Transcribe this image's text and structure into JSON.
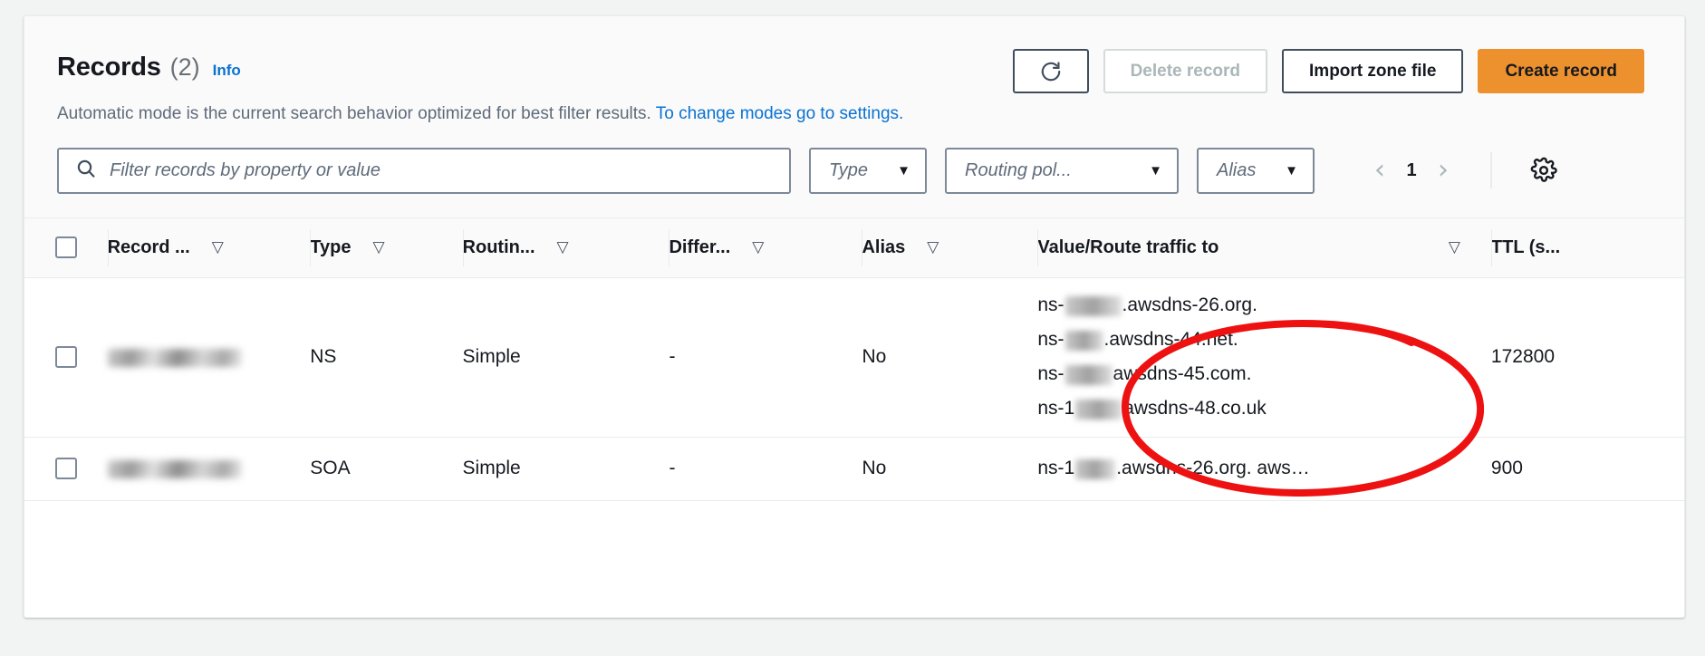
{
  "panel": {
    "title": "Records",
    "count": "(2)",
    "info_label": "Info",
    "description_text": "Automatic mode is the current search behavior optimized for best filter results.",
    "description_link": "To change modes go to settings."
  },
  "toolbar": {
    "refresh_icon": "refresh-icon",
    "delete_label": "Delete record",
    "import_label": "Import zone file",
    "create_label": "Create record",
    "delete_disabled": true
  },
  "filters": {
    "search_placeholder": "Filter records by property or value",
    "search_value": "",
    "search_icon": "search-icon",
    "type_label": "Type",
    "routing_label": "Routing pol...",
    "alias_label": "Alias",
    "caret_icon": "chevron-down-icon"
  },
  "pagination": {
    "prev_icon": "chevron-left-icon",
    "page": "1",
    "next_icon": "chevron-right-icon",
    "settings_icon": "gear-icon"
  },
  "table": {
    "columns": [
      {
        "label": "",
        "name": "select-all"
      },
      {
        "label": "Record ...",
        "name": "record-name"
      },
      {
        "label": "Type",
        "name": "type"
      },
      {
        "label": "Routin...",
        "name": "routing-policy"
      },
      {
        "label": "Differ...",
        "name": "differentiator"
      },
      {
        "label": "Alias",
        "name": "alias"
      },
      {
        "label": "Value/Route traffic to",
        "name": "value"
      },
      {
        "label": "TTL (s...",
        "name": "ttl"
      }
    ],
    "sort_icon": "sort-icon",
    "rows": [
      {
        "record_name": "",
        "type": "NS",
        "routing_policy": "Simple",
        "differentiator": "-",
        "alias": "No",
        "values": [
          {
            "prefix": "ns-",
            "redacted_width": 62,
            "suffix": ".awsdns-26.org."
          },
          {
            "prefix": "ns-",
            "redacted_width": 42,
            "suffix": ".awsdns-44.net."
          },
          {
            "prefix": "ns-",
            "redacted_width": 52,
            "suffix": "awsdns-45.com."
          },
          {
            "prefix": "ns-1",
            "redacted_width": 52,
            "suffix": "awsdns-48.co.uk"
          }
        ],
        "ttl": "172800"
      },
      {
        "record_name": "",
        "type": "SOA",
        "routing_policy": "Simple",
        "differentiator": "-",
        "alias": "No",
        "values": [
          {
            "prefix": "ns-1",
            "redacted_width": 44,
            "suffix": ".awsdns-26.org. aws…"
          }
        ],
        "ttl": "900"
      }
    ]
  },
  "annotation": {
    "shape": "ellipse",
    "color": "#ee1111",
    "target": "Value/Route traffic to values of the NS record"
  },
  "colors": {
    "primary_button": "#ec912d",
    "link": "#0972d3",
    "annotation": "#ee1111",
    "panel_background": "#ffffff",
    "page_background": "#f2f3f3"
  }
}
